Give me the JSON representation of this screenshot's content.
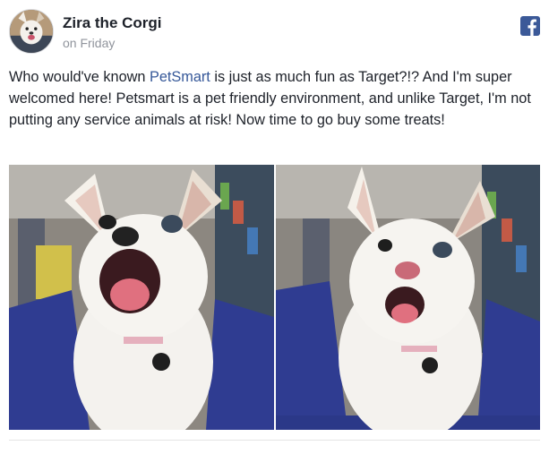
{
  "post": {
    "author": "Zira the Corgi",
    "timestamp": "on Friday",
    "platform_icon": "facebook-icon",
    "message": {
      "before_link": "Who would've known ",
      "link": "PetSmart",
      "after_link": " is just as much fun as Target?!? And I'm super welcomed here! Petsmart is a pet friendly environment, and unlike Target, I'm not putting any service animals at risk! Now time to go buy some treats!"
    },
    "photos": [
      {
        "icon": "photo-corgi-cart-1"
      },
      {
        "icon": "photo-corgi-cart-2"
      }
    ]
  },
  "colors": {
    "link": "#365899",
    "facebook_blue": "#3b5998",
    "cart_blue": "#2d3a8c",
    "text": "#1d2129",
    "muted": "#90949c"
  }
}
